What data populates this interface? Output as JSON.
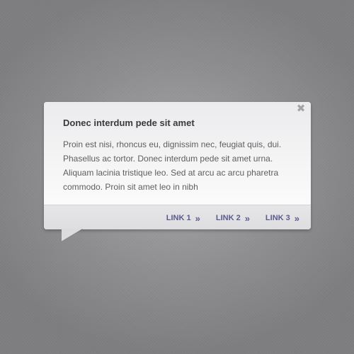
{
  "popover": {
    "title": "Donec interdum pede sit amet",
    "body": "Proin est nisi, rhoncus eu, dignissim nec, feugiat quis, dui. Phasellus ac tortor. Donec interdum pede sit amet urna. Aliquam lacinia tristique leo. Sed at arcu ac arcu pharetra commodo. Proin sit amet leo in nibh",
    "close_icon": "close-icon",
    "close_glyph": "✖",
    "links": [
      {
        "label": "LINK 1",
        "chevron": "»"
      },
      {
        "label": "LINK 2",
        "chevron": "»"
      },
      {
        "label": "LINK 3",
        "chevron": "»"
      }
    ]
  },
  "colors": {
    "background": "#8f8f91",
    "title": "#3a3a3c",
    "body_text": "#5e5e60",
    "link": "#5a5a8f",
    "footer": "#e2e2e4"
  }
}
